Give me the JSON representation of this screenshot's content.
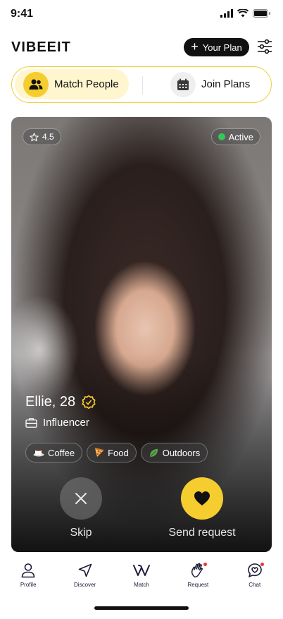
{
  "status_bar": {
    "time": "9:41"
  },
  "header": {
    "logo": "VIBEEIT",
    "plan_button": "Your Plan"
  },
  "toggle": {
    "match_label": "Match People",
    "join_label": "Join Plans"
  },
  "profile": {
    "rating": "4.5",
    "status": "Active",
    "name_age": "Ellie, 28",
    "occupation": "Influencer",
    "tags": [
      {
        "icon": "coffee-icon",
        "label": "Coffee"
      },
      {
        "icon": "pizza-icon",
        "label": "Food"
      },
      {
        "icon": "leaf-icon",
        "label": "Outdoors"
      }
    ],
    "skip_label": "Skip",
    "send_label": "Send request"
  },
  "nav": {
    "profile": "Profile",
    "discover": "Discover",
    "match": "Match",
    "request": "Request",
    "chat": "Chat"
  },
  "colors": {
    "accent": "#f5cd2e",
    "active_dot": "#34c759",
    "notification": "#e53935"
  }
}
